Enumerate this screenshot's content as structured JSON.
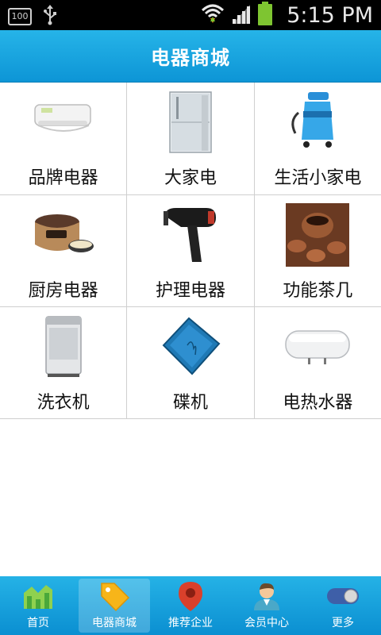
{
  "status_bar": {
    "battery_badge": "100",
    "time": "5:15 PM"
  },
  "header": {
    "title": "电器商城"
  },
  "categories": [
    {
      "label": "品牌电器",
      "icon": "air-conditioner"
    },
    {
      "label": "大家电",
      "icon": "refrigerator"
    },
    {
      "label": "生活小家电",
      "icon": "vacuum-cleaner"
    },
    {
      "label": "厨房电器",
      "icon": "rice-cooker"
    },
    {
      "label": "护理电器",
      "icon": "hair-dryer"
    },
    {
      "label": "功能茶几",
      "icon": "tea-set"
    },
    {
      "label": "洗衣机",
      "icon": "washing-machine"
    },
    {
      "label": "碟机",
      "icon": "disc-player"
    },
    {
      "label": "电热水器",
      "icon": "water-heater"
    }
  ],
  "bottom_nav": {
    "items": [
      {
        "label": "首页",
        "icon": "home-chart-icon"
      },
      {
        "label": "电器商城",
        "icon": "price-tag-icon",
        "active": true
      },
      {
        "label": "推荐企业",
        "icon": "map-pin-icon"
      },
      {
        "label": "会员中心",
        "icon": "member-avatar-icon"
      },
      {
        "label": "更多",
        "icon": "toggle-icon"
      }
    ]
  },
  "colors": {
    "header_blue": "#0d95d6",
    "nav_blue": "#25b2e6",
    "status_bar": "#000000",
    "battery_green": "#7ec531"
  }
}
